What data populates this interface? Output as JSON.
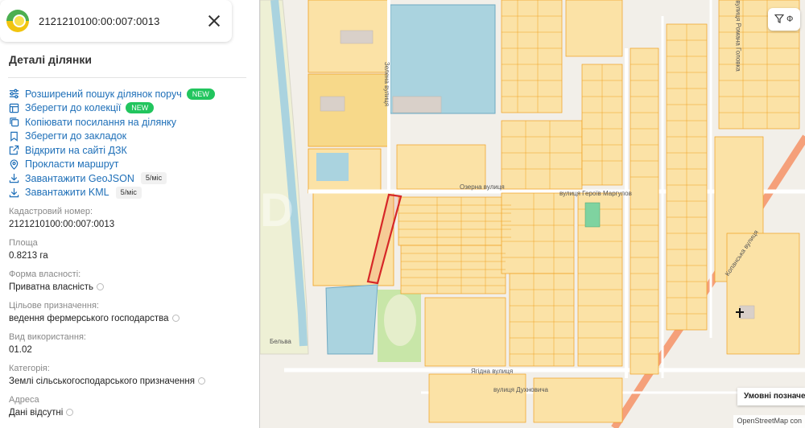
{
  "search": {
    "query": "2121210100:00:007:0013"
  },
  "panel": {
    "title": "Деталі ділянки",
    "actions": [
      {
        "label": "Розширений пошук ділянок поруч",
        "icon": "sliders-icon",
        "badge": "NEW",
        "rate": ""
      },
      {
        "label": "Зберегти до колекції",
        "icon": "collection-icon",
        "badge": "NEW",
        "rate": ""
      },
      {
        "label": "Копіювати посилання на ділянку",
        "icon": "copy-icon",
        "badge": "",
        "rate": ""
      },
      {
        "label": "Зберегти до закладок",
        "icon": "bookmark-icon",
        "badge": "",
        "rate": ""
      },
      {
        "label": "Відкрити на сайті ДЗК",
        "icon": "external-link-icon",
        "badge": "",
        "rate": ""
      },
      {
        "label": "Прокласти маршрут",
        "icon": "location-pin-icon",
        "badge": "",
        "rate": ""
      },
      {
        "label": "Завантажити GeoJSON",
        "icon": "download-icon",
        "badge": "",
        "rate": "5/міс"
      },
      {
        "label": "Завантажити KML",
        "icon": "download-icon",
        "badge": "",
        "rate": "5/міс"
      }
    ],
    "fields": [
      {
        "label": "Кадастровий номер:",
        "value": "2121210100:00:007:0013"
      },
      {
        "label": "Площа",
        "value": "0.8213 га"
      },
      {
        "label": "Форма власності:",
        "value": "Приватна власність"
      },
      {
        "label": "Цільове призначення:",
        "value": "ведення фермерського господарства"
      },
      {
        "label": "Вид використання:",
        "value": "01.02"
      },
      {
        "label": "Категорія:",
        "value": "Землі сільськогосподарського призначення"
      },
      {
        "label": "Адреса",
        "value": "Дані відсутні"
      }
    ]
  },
  "map": {
    "filter_label": "Ф",
    "legend_label": "Умовні позначення",
    "attribution": "OpenStreetMap con",
    "watermark": "D",
    "streets": [
      "Озерна вулиця",
      "вулиця Героїв Маргулов",
      "вулиця Романа Головка",
      "Ягідна вулиця",
      "вулиця Духновича",
      "Копанська вулиця",
      "Бельва",
      "Зелена вулиця"
    ],
    "colors": {
      "background": "#f2efe9",
      "parcel_fill": "#fbe2a6",
      "parcel_stroke": "#f0a020",
      "selected": "#d62728",
      "water": "#aad3df",
      "road": "#ffffff",
      "main_road": "#f5a07a",
      "green": "#c8e6a8",
      "farmland": "#eef0d5"
    }
  }
}
